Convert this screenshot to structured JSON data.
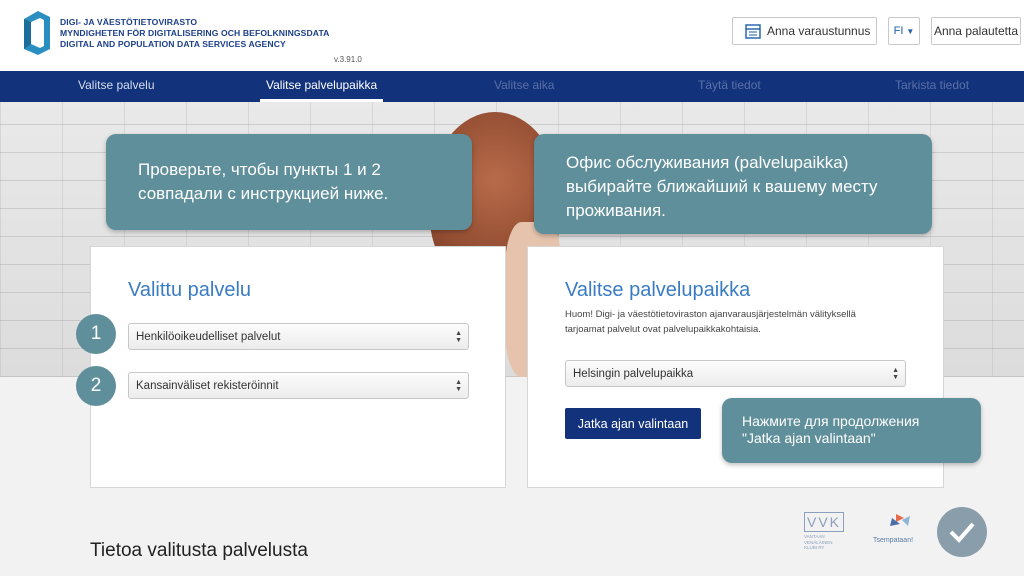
{
  "header": {
    "agency_lines": [
      "DIGI- JA VÄESTÖTIETOVIRASTO",
      "MYNDIGHETEN FÖR DIGITALISERING OCH BEFOLKNINGSDATA",
      "DIGITAL AND POPULATION DATA SERVICES AGENCY"
    ],
    "version": "v.3.91.0",
    "booking_code_label": "Anna varaustunnus",
    "language": "FI",
    "feedback_label": "Anna palautetta"
  },
  "nav": {
    "steps": [
      {
        "label": "Valitse palvelu",
        "state": "done"
      },
      {
        "label": "Valitse palvelupaikka",
        "state": "active"
      },
      {
        "label": "Valitse aika",
        "state": "disabled"
      },
      {
        "label": "Täytä tiedot",
        "state": "disabled"
      },
      {
        "label": "Tarkista tiedot",
        "state": "disabled"
      }
    ]
  },
  "left_card": {
    "title": "Valittu palvelu",
    "select_1": "Henkilöoikeudelliset palvelut",
    "select_2": "Kansainväliset rekisteröinnit"
  },
  "right_card": {
    "title": "Valitse palvelupaikka",
    "notice": "Huom! Digi- ja väestötietoviraston ajanvarausjärjestelmän välityksellä tarjoamat palvelut ovat palvelupaikkakohtaisia.",
    "location_select": "Helsingin palvelupaikka",
    "continue_label": "Jatka ajan valintaan"
  },
  "callouts": {
    "check_items": "Проверьте, чтобы пункты 1 и 2 совпадали с инструкцией ниже.",
    "office_hint": "Офис обслуживания  (palvelupaikka) выбирайте ближайший к вашему месту проживания.",
    "continue_hint": "Нажмите для продолжения \"Jatka ajan valintaan\""
  },
  "steps": {
    "one": "1",
    "two": "2"
  },
  "section": {
    "title": "Tietoa valitusta palvelusta"
  },
  "partners": {
    "vvk_lines": [
      "VANTAAN",
      "VENÄLÄINEN",
      "KLUBI RY"
    ],
    "vvk_letters": "VVK",
    "tsempataan": "Tsempataan!"
  },
  "colors": {
    "nav_bg": "#12327b",
    "accent": "#3a7cc4",
    "callout": "#5f8f9b",
    "button": "#12327b"
  }
}
